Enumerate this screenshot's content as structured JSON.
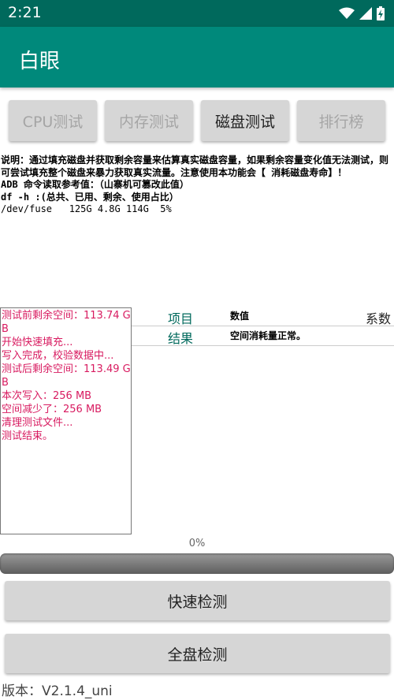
{
  "status": {
    "time": "2:21"
  },
  "app": {
    "title": "白眼"
  },
  "tabs": [
    {
      "label": "CPU测试"
    },
    {
      "label": "内存测试"
    },
    {
      "label": "磁盘测试"
    },
    {
      "label": "排行榜"
    }
  ],
  "description": {
    "line1": "说明：通过填充磁盘并获取剩余容量来估算真实磁盘容量，如果剩余容量变化值无法测试，则可尝试填充整个磁盘来暴力获取真实流量。注意使用本功能会【 消耗磁盘寿命】！",
    "line2": "ADB 命令读取参考值：（山寨机可篡改此值）",
    "line3": "df -h :(总共、已用、剩余、使用占比）",
    "line4": "/dev/fuse   125G 4.8G 114G  5%"
  },
  "log": {
    "lines": [
      "测试前剩余空间：113.74 GB",
      "开始快速填充...",
      "写入完成，校验数据中...",
      "测试后剩余空间：113.49 GB",
      "本次写入：256 MB",
      "空间减少了：256 MB",
      "清理测试文件...",
      "测试结束。"
    ]
  },
  "table": {
    "header": {
      "item": "项目",
      "value": "数值",
      "coef": "系数"
    },
    "row": {
      "item": "结果",
      "value": "空间消耗量正常。",
      "coef": ""
    }
  },
  "progress": {
    "text": "0%",
    "value": 0
  },
  "buttons": {
    "quick": "快速检测",
    "full": "全盘检测"
  },
  "version": "版本：V2.1.4_uni",
  "colors": {
    "primary": "#00897b",
    "primary_dark": "#00695c",
    "log_text": "#d81b60"
  }
}
